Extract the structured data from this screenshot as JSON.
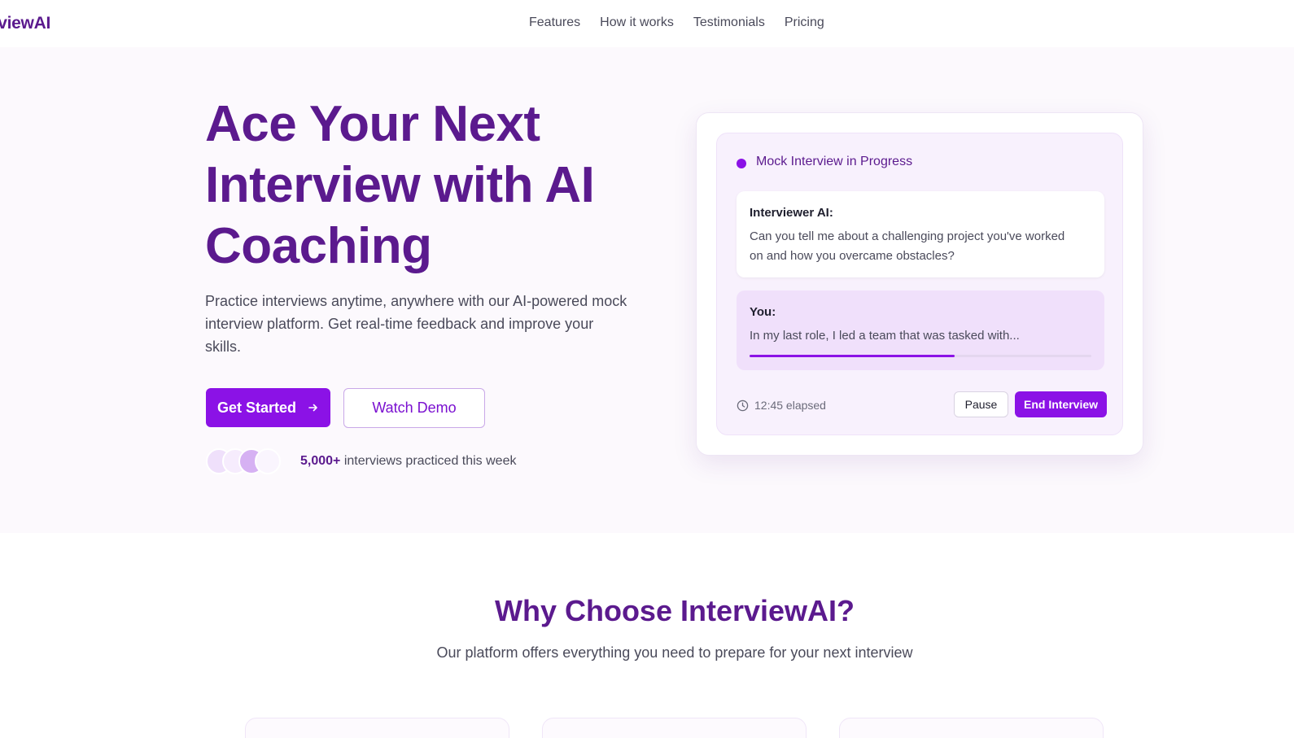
{
  "brand": {
    "logo_text": "erviewAI"
  },
  "nav": {
    "links": [
      {
        "label": "Features"
      },
      {
        "label": "How it works"
      },
      {
        "label": "Testimonials"
      },
      {
        "label": "Pricing"
      }
    ]
  },
  "hero": {
    "title": "Ace Your Next Interview with AI Coaching",
    "subtitle": "Practice interviews anytime, anywhere with our AI-powered mock interview platform. Get real-time feedback and improve your skills.",
    "primary_cta": "Get Started",
    "primary_cta_icon": "arrow-right-icon",
    "secondary_cta": "Watch Demo",
    "social_proof": {
      "count": "5,000+",
      "text": " interviews practiced this week"
    }
  },
  "interview_card": {
    "status": "Mock Interview in Progress",
    "interviewer": {
      "label": "Interviewer AI:",
      "text": "Can you tell me about a challenging project you've worked on and how you overcame obstacles?"
    },
    "you": {
      "label": "You:",
      "text": "In my last role, I led a team that was tasked with...",
      "progress": 0.6
    },
    "elapsed": "12:45 elapsed",
    "elapsed_icon": "clock-icon",
    "pause_label": "Pause",
    "end_label": "End Interview"
  },
  "features_section": {
    "title": "Why Choose InterviewAI?",
    "subtitle": "Our platform offers everything you need to prepare for your next interview"
  },
  "colors": {
    "brand": "#5b1a8e",
    "accent": "#8b12e6",
    "hero_bg": "#fcf9fd"
  }
}
